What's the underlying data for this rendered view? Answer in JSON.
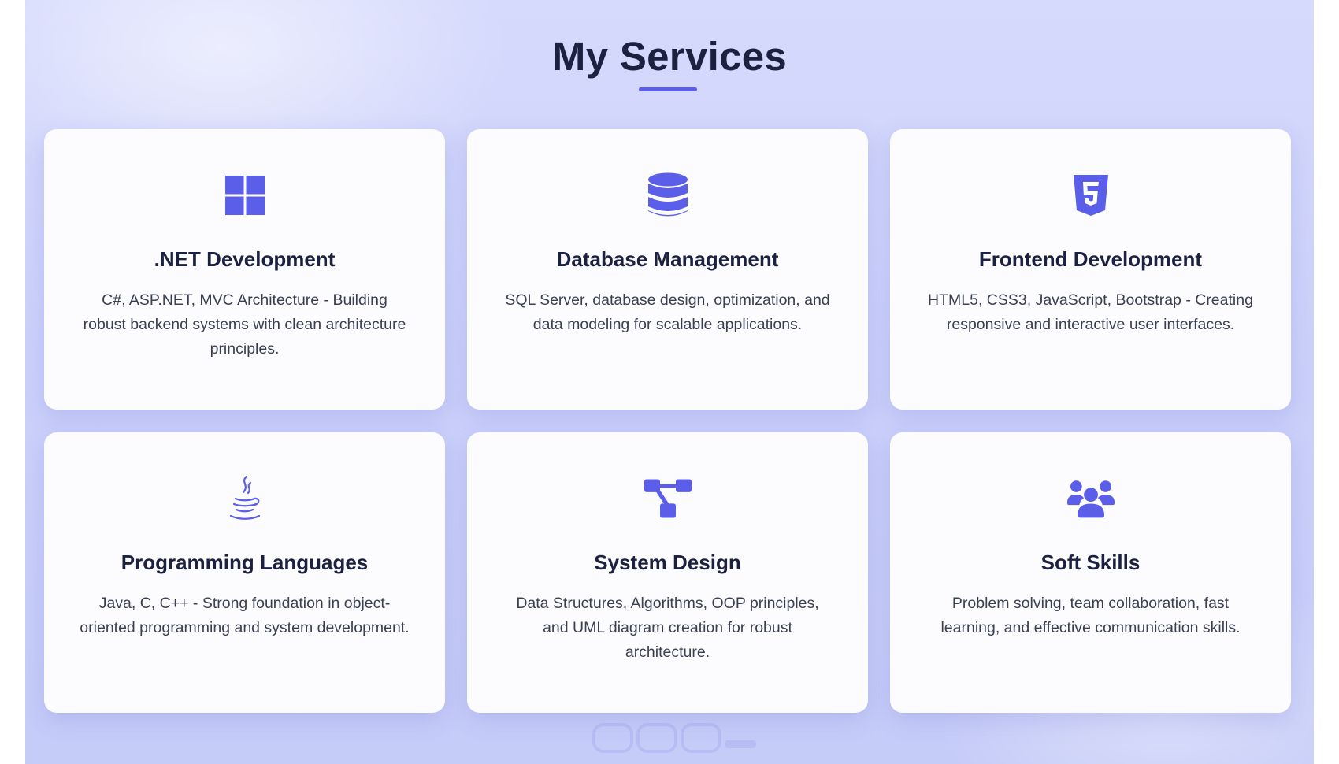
{
  "section": {
    "title": "My Services"
  },
  "theme": {
    "accent": "#5b5ee8",
    "title_color": "#1c2140",
    "text_color": "#3b3f52",
    "card_background": "#fcfcfe",
    "page_background": "#ccd1fa"
  },
  "services": [
    {
      "icon": "windows-icon",
      "title": ".NET Development",
      "description": "C#, ASP.NET, MVC Architecture - Building robust backend systems with clean architecture principles."
    },
    {
      "icon": "database-icon",
      "title": "Database Management",
      "description": "SQL Server, database design, optimization, and data modeling for scalable applications."
    },
    {
      "icon": "html5-icon",
      "title": "Frontend Development",
      "description": "HTML5, CSS3, JavaScript, Bootstrap - Creating responsive and interactive user interfaces."
    },
    {
      "icon": "java-icon",
      "title": "Programming Languages",
      "description": "Java, C, C++ - Strong foundation in object-oriented programming and system development."
    },
    {
      "icon": "diagram-project-icon",
      "title": "System Design",
      "description": "Data Structures, Algorithms, OOP principles, and UML diagram creation for robust architecture."
    },
    {
      "icon": "users-icon",
      "title": "Soft Skills",
      "description": "Problem solving, team collaboration, fast learning, and effective communication skills."
    }
  ]
}
